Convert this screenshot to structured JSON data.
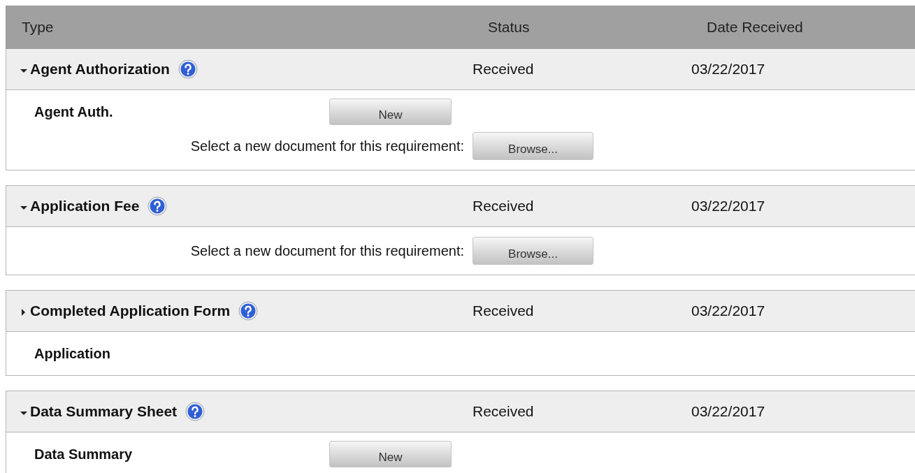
{
  "table": {
    "columns": [
      "Type",
      "Status",
      "Date Received"
    ],
    "sections": [
      {
        "title": "Agent Authorization",
        "expanded": true,
        "status": "Received",
        "date": "03/22/2017",
        "items": [
          {
            "kind": "document",
            "name": "Agent Auth.",
            "button": "New"
          },
          {
            "kind": "browse",
            "label": "Select a new document for this requirement:",
            "button": "Browse..."
          }
        ]
      },
      {
        "title": "Application Fee",
        "expanded": true,
        "status": "Received",
        "date": "03/22/2017",
        "items": [
          {
            "kind": "browse",
            "label": "Select a new document for this requirement:",
            "button": "Browse..."
          }
        ]
      },
      {
        "title": "Completed Application Form",
        "expanded": false,
        "status": "Received",
        "date": "03/22/2017",
        "items": [
          {
            "kind": "document",
            "name": "Application"
          }
        ]
      },
      {
        "title": "Data Summary Sheet",
        "expanded": true,
        "status": "Received",
        "date": "03/22/2017",
        "items": [
          {
            "kind": "document",
            "name": "Data Summary",
            "button": "New"
          }
        ]
      }
    ]
  }
}
